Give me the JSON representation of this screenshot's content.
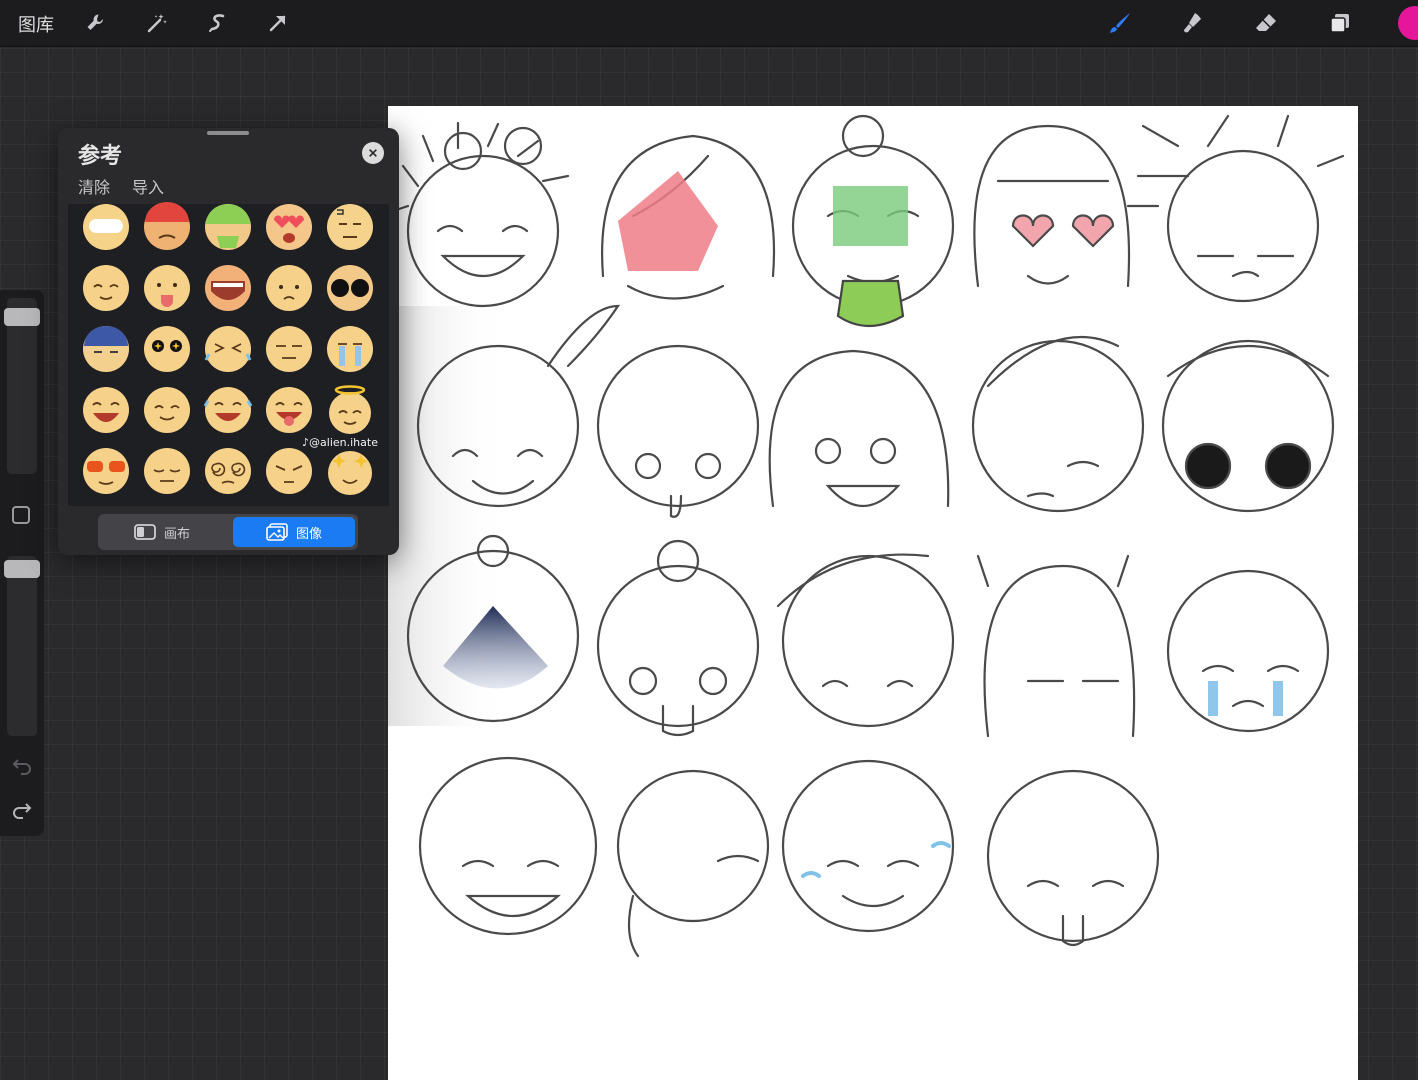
{
  "topbar": {
    "gallery_label": "图库",
    "left_tools": [
      "wrench-icon",
      "magic-wand-icon",
      "selection-icon",
      "transform-arrow-icon"
    ],
    "right_tools": [
      "brush-icon",
      "smudge-icon",
      "eraser-icon",
      "layers-icon"
    ],
    "current_color": "#e6169a"
  },
  "reference_panel": {
    "title": "参考",
    "actions": {
      "clear": "清除",
      "import": "导入"
    },
    "watermark": "@alien.ihate",
    "toggle": {
      "canvas_label": "画布",
      "image_label": "图像",
      "selected": "image"
    },
    "accent": "#1a7bf2",
    "emoji_grid": [
      [
        "grinning-white-eyes",
        "red-angry",
        "green-sick",
        "heart-eyes",
        "confused-scribble"
      ],
      [
        "content-smile",
        "tongue-out",
        "big-mouth-open",
        "sad-small",
        "sunglasses-dark"
      ],
      [
        "blue-scared",
        "star-eyes",
        "squint-cry",
        "neutral-line",
        "crying-tears"
      ],
      [
        "laughing-open",
        "calm-smile",
        "laugh-tears",
        "tongue-laugh",
        "angel-halo"
      ],
      [
        "cool-shades",
        "sleepy",
        "dizzy-swirl",
        "suspicious",
        "sparkle-smile"
      ]
    ]
  },
  "canvas": {
    "background": "#ffffff",
    "sketch_rows": 4,
    "sketch_count": 19
  }
}
